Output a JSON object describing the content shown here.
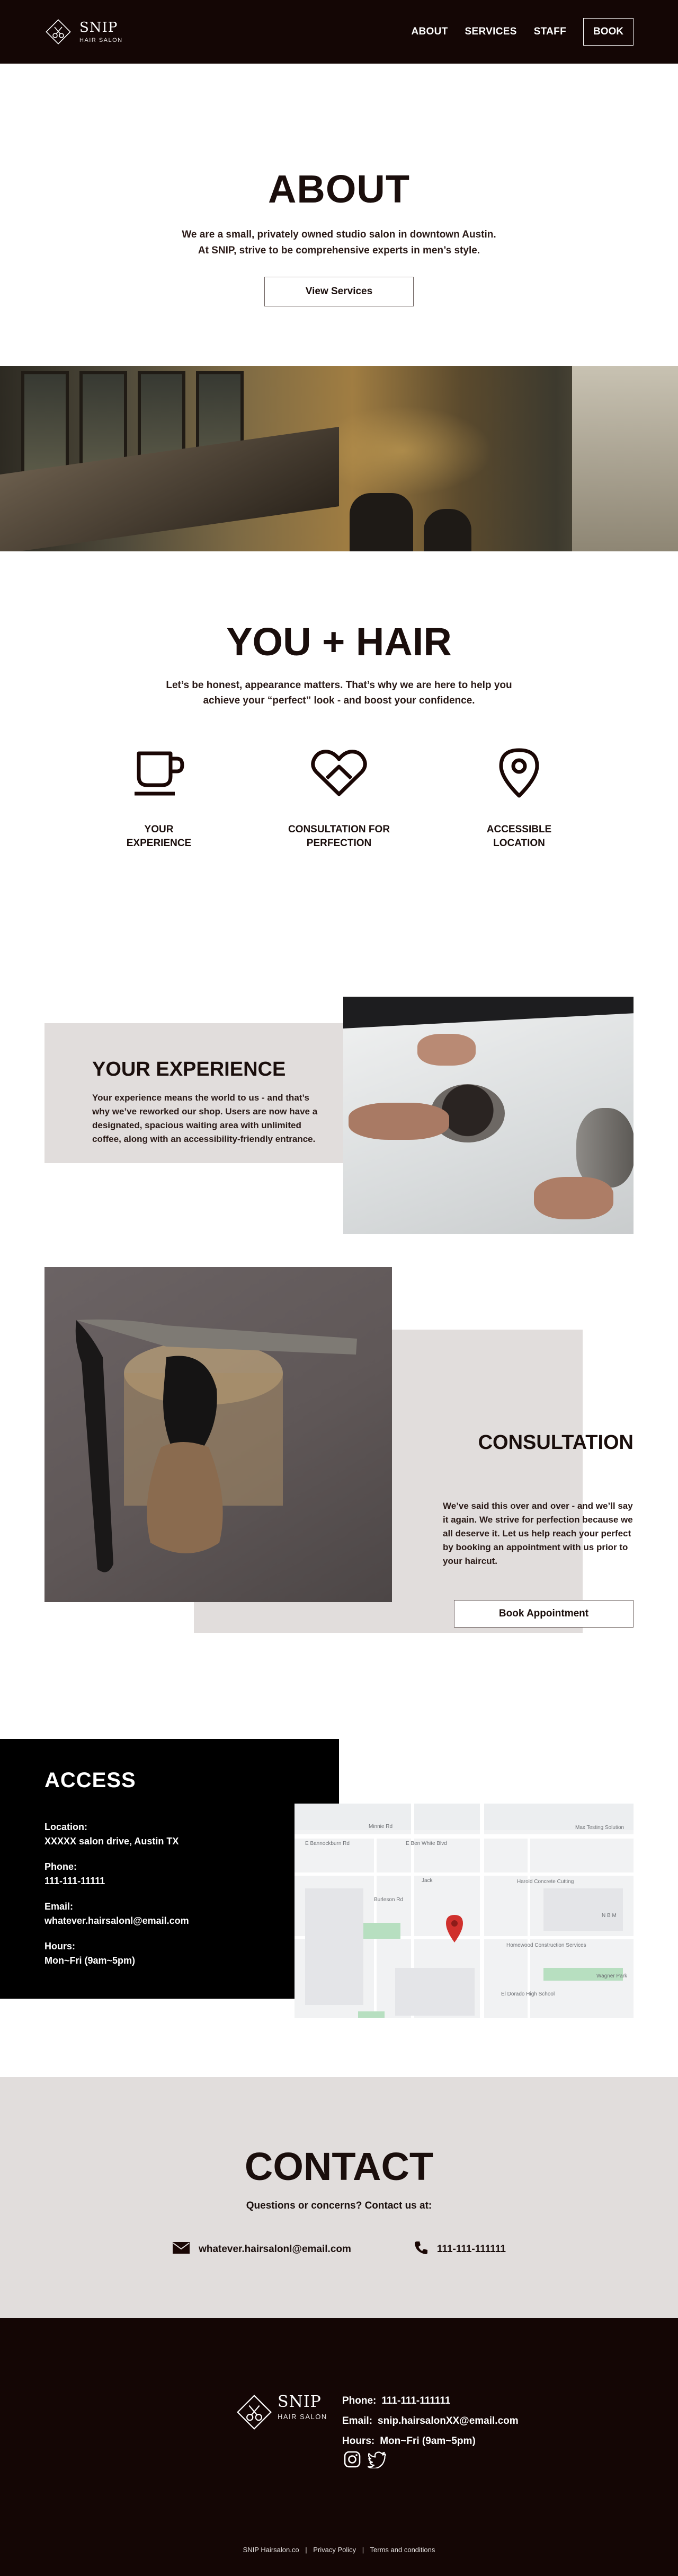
{
  "header": {
    "brand": "SNIP",
    "brand_sub": "HAIR SALON",
    "nav": [
      {
        "label": "ABOUT"
      },
      {
        "label": "SERVICES"
      },
      {
        "label": "STAFF"
      }
    ],
    "book_label": "BOOK"
  },
  "about": {
    "title": "ABOUT",
    "line1": "We are a small, privately owned studio salon in downtown Austin.",
    "line2": "At SNIP, strive to be comprehensive experts in men’s style.",
    "button": "View Services"
  },
  "youhair": {
    "title": "YOU + HAIR",
    "line1": "Let’s be honest, appearance matters. That’s why we are here to help you",
    "line2": "achieve your “perfect” look - and boost your confidence.",
    "features": [
      {
        "line1": "YOUR",
        "line2": "EXPERIENCE",
        "icon": "coffee-cup-icon"
      },
      {
        "line1": "CONSULTATION FOR",
        "line2": "PERFECTION",
        "icon": "heart-icon"
      },
      {
        "line1": "ACCESSIBLE",
        "line2": "LOCATION",
        "icon": "location-pin-icon"
      }
    ]
  },
  "experience": {
    "title": "YOUR EXPERIENCE",
    "text": "Your experience means the world to us - and that’s why we’ve reworked our shop. Users are now have a designated, spacious waiting area with unlimited coffee, along with an accessibility-friendly entrance."
  },
  "consultation": {
    "title": "CONSULTATION",
    "text": "We’ve said this over and over - and we’ll say it again. We strive for perfection because we all deserve it. Let us help reach your perfect by booking an appointment with us prior to your haircut.",
    "button": "Book Appointment"
  },
  "access": {
    "title": "ACCESS",
    "location_label": "Location:",
    "location_value": "XXXXX salon drive, Austin TX",
    "phone_label": "Phone:",
    "phone_value": "111-111-11111",
    "email_label": "Email:",
    "email_value": "whatever.hairsalonl@email.com",
    "hours_label": "Hours:",
    "hours_value": "Mon~Fri (9am~5pm)",
    "map_labels": {
      "ben_white": "E Ben White Blvd",
      "woodward": "Woodward St",
      "freeway": "E Bannockburn Rd",
      "max_testing": "Max Testing Solution",
      "concrete": "Harold Concrete Cutting",
      "homeowner": "Homewood Construction Services",
      "school": "El Dorado High School",
      "wagner": "Wagner Park",
      "nbm": "N B M",
      "jack": "Jack",
      "burleson": "Burleson Rd",
      "minnie": "Minnie Rd"
    }
  },
  "contact": {
    "title": "CONTACT",
    "subtitle": "Questions or concerns? Contact us at:",
    "email": "whatever.hairsalonl@email.com",
    "phone": "111-111-111111"
  },
  "footer": {
    "brand": "SNIP",
    "brand_sub": "HAIR SALON",
    "phone_label": "Phone:",
    "phone_value": "111-111-111111",
    "email_label": "Email:",
    "email_value": "snip.hairsalonXX@email.com",
    "hours_label": "Hours:",
    "hours_value": "Mon~Fri (9am~5pm)",
    "links": [
      "SNIP Hairsalon.co",
      "Privacy Policy",
      "Terms and conditions"
    ],
    "sep": "|"
  },
  "colors": {
    "dark": "#140605",
    "light_gray": "#e1dddc",
    "map_pin": "#d0312d"
  }
}
